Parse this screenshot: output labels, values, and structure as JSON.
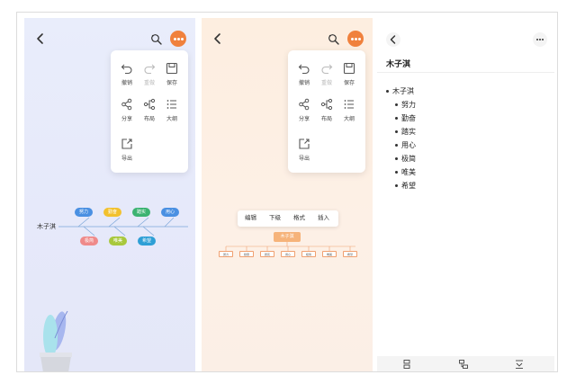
{
  "menu": {
    "undo": "撤销",
    "redo": "重做",
    "save": "保存",
    "share": "分享",
    "layout": "布局",
    "outline": "大纲",
    "export": "导出"
  },
  "mindmap": {
    "root": "木子淇",
    "nodes": [
      {
        "label": "努力",
        "color": "#4a90e2"
      },
      {
        "label": "勤奋",
        "color": "#f2c12e"
      },
      {
        "label": "踏实",
        "color": "#3cb371"
      },
      {
        "label": "用心",
        "color": "#4a90e2"
      },
      {
        "label": "极简",
        "color": "#ef8a8a"
      },
      {
        "label": "唯美",
        "color": "#a8c83c"
      },
      {
        "label": "希望",
        "color": "#2e9fd6"
      }
    ]
  },
  "toolbar": {
    "edit": "编辑",
    "child": "下级",
    "format": "格式",
    "insert": "插入"
  },
  "tree": {
    "root": "木子淇",
    "children": [
      "努力",
      "勤奋",
      "踏实",
      "用心",
      "极简",
      "唯美",
      "希望"
    ]
  },
  "outline": {
    "title": "木子淇",
    "root": "木子淇",
    "items": [
      "努力",
      "勤奋",
      "踏实",
      "用心",
      "极简",
      "唯美",
      "希望"
    ]
  },
  "colors": {
    "accent": "#f0813d",
    "panel1_bg": "#e7ebfa",
    "panel2_bg": "#fdefe3"
  }
}
